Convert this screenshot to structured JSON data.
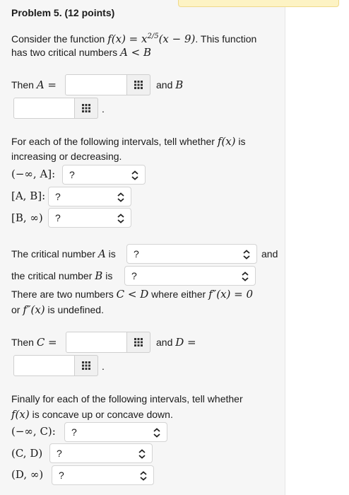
{
  "problem": {
    "title": "Problem 5.",
    "points": "(12 points)"
  },
  "intro": {
    "line1_pre": "Consider the function ",
    "function": "f(x) = x^{2/5}(x − 9)",
    "line1_post": ". This function",
    "line2": "has two critical numbers ",
    "cond": "A < B"
  },
  "then_ab": {
    "then": "Then ",
    "A_eq": "A =",
    "and": "and ",
    "B": "B",
    "period": "."
  },
  "monotonic": {
    "question_line1": "For each of the following intervals, tell whether ",
    "fx": "f(x)",
    "question_line1_post": " is",
    "question_line2": "increasing or decreasing.",
    "intervals": [
      {
        "label": "(−∞, A]:",
        "value": "?"
      },
      {
        "label": "[A, B]:",
        "value": "?"
      },
      {
        "label": "[B, ∞)",
        "value": "?"
      }
    ]
  },
  "critical": {
    "a_text": "The critical number ",
    "a_var": "A",
    "a_is": " is",
    "a_value": "?",
    "and": "and",
    "b_text": "the critical number ",
    "b_var": "B",
    "b_is": " is",
    "b_value": "?"
  },
  "second": {
    "line1_pre": "There are two numbers ",
    "cond": "C < D",
    "line1_mid": " where either ",
    "fpp": "f″(x) = 0",
    "line2_pre": "or ",
    "fpp2": "f″(x)",
    "line2_post": " is undefined."
  },
  "then_cd": {
    "then": "Then ",
    "C_eq": "C =",
    "and": "and ",
    "D_eq": "D =",
    "period": "."
  },
  "concavity": {
    "line1": "Finally for each of the following intervals, tell whether",
    "fx": "f(x)",
    "line2_post": " is concave up or concave down.",
    "intervals": [
      {
        "label": "(−∞, C):",
        "value": "?"
      },
      {
        "label": "(C, D)",
        "value": "?"
      },
      {
        "label": "(D, ∞)",
        "value": "?"
      }
    ]
  }
}
